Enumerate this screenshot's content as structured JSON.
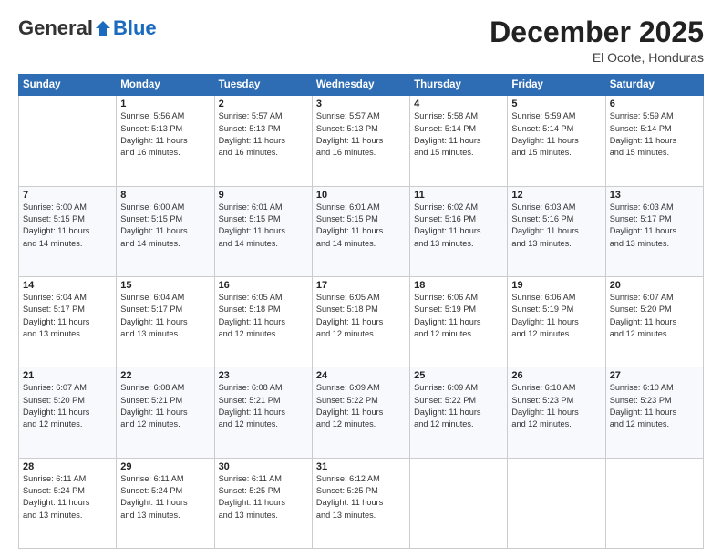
{
  "brand": {
    "name_general": "General",
    "name_blue": "Blue",
    "tagline": ""
  },
  "header": {
    "month": "December 2025",
    "location": "El Ocote, Honduras"
  },
  "days_of_week": [
    "Sunday",
    "Monday",
    "Tuesday",
    "Wednesday",
    "Thursday",
    "Friday",
    "Saturday"
  ],
  "weeks": [
    [
      {
        "day": "",
        "info": ""
      },
      {
        "day": "1",
        "info": "Sunrise: 5:56 AM\nSunset: 5:13 PM\nDaylight: 11 hours\nand 16 minutes."
      },
      {
        "day": "2",
        "info": "Sunrise: 5:57 AM\nSunset: 5:13 PM\nDaylight: 11 hours\nand 16 minutes."
      },
      {
        "day": "3",
        "info": "Sunrise: 5:57 AM\nSunset: 5:13 PM\nDaylight: 11 hours\nand 16 minutes."
      },
      {
        "day": "4",
        "info": "Sunrise: 5:58 AM\nSunset: 5:14 PM\nDaylight: 11 hours\nand 15 minutes."
      },
      {
        "day": "5",
        "info": "Sunrise: 5:59 AM\nSunset: 5:14 PM\nDaylight: 11 hours\nand 15 minutes."
      },
      {
        "day": "6",
        "info": "Sunrise: 5:59 AM\nSunset: 5:14 PM\nDaylight: 11 hours\nand 15 minutes."
      }
    ],
    [
      {
        "day": "7",
        "info": "Sunrise: 6:00 AM\nSunset: 5:15 PM\nDaylight: 11 hours\nand 14 minutes."
      },
      {
        "day": "8",
        "info": "Sunrise: 6:00 AM\nSunset: 5:15 PM\nDaylight: 11 hours\nand 14 minutes."
      },
      {
        "day": "9",
        "info": "Sunrise: 6:01 AM\nSunset: 5:15 PM\nDaylight: 11 hours\nand 14 minutes."
      },
      {
        "day": "10",
        "info": "Sunrise: 6:01 AM\nSunset: 5:15 PM\nDaylight: 11 hours\nand 14 minutes."
      },
      {
        "day": "11",
        "info": "Sunrise: 6:02 AM\nSunset: 5:16 PM\nDaylight: 11 hours\nand 13 minutes."
      },
      {
        "day": "12",
        "info": "Sunrise: 6:03 AM\nSunset: 5:16 PM\nDaylight: 11 hours\nand 13 minutes."
      },
      {
        "day": "13",
        "info": "Sunrise: 6:03 AM\nSunset: 5:17 PM\nDaylight: 11 hours\nand 13 minutes."
      }
    ],
    [
      {
        "day": "14",
        "info": "Sunrise: 6:04 AM\nSunset: 5:17 PM\nDaylight: 11 hours\nand 13 minutes."
      },
      {
        "day": "15",
        "info": "Sunrise: 6:04 AM\nSunset: 5:17 PM\nDaylight: 11 hours\nand 13 minutes."
      },
      {
        "day": "16",
        "info": "Sunrise: 6:05 AM\nSunset: 5:18 PM\nDaylight: 11 hours\nand 12 minutes."
      },
      {
        "day": "17",
        "info": "Sunrise: 6:05 AM\nSunset: 5:18 PM\nDaylight: 11 hours\nand 12 minutes."
      },
      {
        "day": "18",
        "info": "Sunrise: 6:06 AM\nSunset: 5:19 PM\nDaylight: 11 hours\nand 12 minutes."
      },
      {
        "day": "19",
        "info": "Sunrise: 6:06 AM\nSunset: 5:19 PM\nDaylight: 11 hours\nand 12 minutes."
      },
      {
        "day": "20",
        "info": "Sunrise: 6:07 AM\nSunset: 5:20 PM\nDaylight: 11 hours\nand 12 minutes."
      }
    ],
    [
      {
        "day": "21",
        "info": "Sunrise: 6:07 AM\nSunset: 5:20 PM\nDaylight: 11 hours\nand 12 minutes."
      },
      {
        "day": "22",
        "info": "Sunrise: 6:08 AM\nSunset: 5:21 PM\nDaylight: 11 hours\nand 12 minutes."
      },
      {
        "day": "23",
        "info": "Sunrise: 6:08 AM\nSunset: 5:21 PM\nDaylight: 11 hours\nand 12 minutes."
      },
      {
        "day": "24",
        "info": "Sunrise: 6:09 AM\nSunset: 5:22 PM\nDaylight: 11 hours\nand 12 minutes."
      },
      {
        "day": "25",
        "info": "Sunrise: 6:09 AM\nSunset: 5:22 PM\nDaylight: 11 hours\nand 12 minutes."
      },
      {
        "day": "26",
        "info": "Sunrise: 6:10 AM\nSunset: 5:23 PM\nDaylight: 11 hours\nand 12 minutes."
      },
      {
        "day": "27",
        "info": "Sunrise: 6:10 AM\nSunset: 5:23 PM\nDaylight: 11 hours\nand 12 minutes."
      }
    ],
    [
      {
        "day": "28",
        "info": "Sunrise: 6:11 AM\nSunset: 5:24 PM\nDaylight: 11 hours\nand 13 minutes."
      },
      {
        "day": "29",
        "info": "Sunrise: 6:11 AM\nSunset: 5:24 PM\nDaylight: 11 hours\nand 13 minutes."
      },
      {
        "day": "30",
        "info": "Sunrise: 6:11 AM\nSunset: 5:25 PM\nDaylight: 11 hours\nand 13 minutes."
      },
      {
        "day": "31",
        "info": "Sunrise: 6:12 AM\nSunset: 5:25 PM\nDaylight: 11 hours\nand 13 minutes."
      },
      {
        "day": "",
        "info": ""
      },
      {
        "day": "",
        "info": ""
      },
      {
        "day": "",
        "info": ""
      }
    ]
  ]
}
